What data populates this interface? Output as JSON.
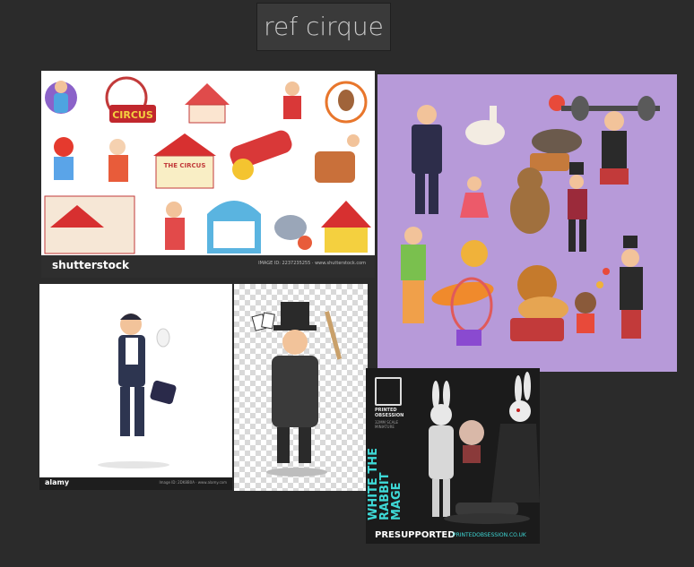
{
  "board": {
    "title": "ref cirque"
  },
  "cards": {
    "circus_collection": {
      "brand": "shutterstock",
      "sign_circus": "CIRCUS",
      "sign_the_circus": "THE CIRCUS",
      "meta": "IMAGE ID: 2237235255 · www.shutterstock.com"
    },
    "magician_white": {
      "brand": "alamy",
      "meta": "Image ID: 2DK8B0A · www.alamy.com"
    },
    "printed_obsession": {
      "brand": "PRINTED OBSESSION",
      "scale": "32MM SCALE MINIATURE",
      "title": "WHITE THE RABBIT\nMAGE",
      "badge": "PRESUPPORTED",
      "website": "PRINTEDOBSESSION.CO.UK"
    }
  },
  "colors": {
    "background": "#2b2b2b",
    "purple": "#b79ad9",
    "teal": "#3ed8d6"
  }
}
